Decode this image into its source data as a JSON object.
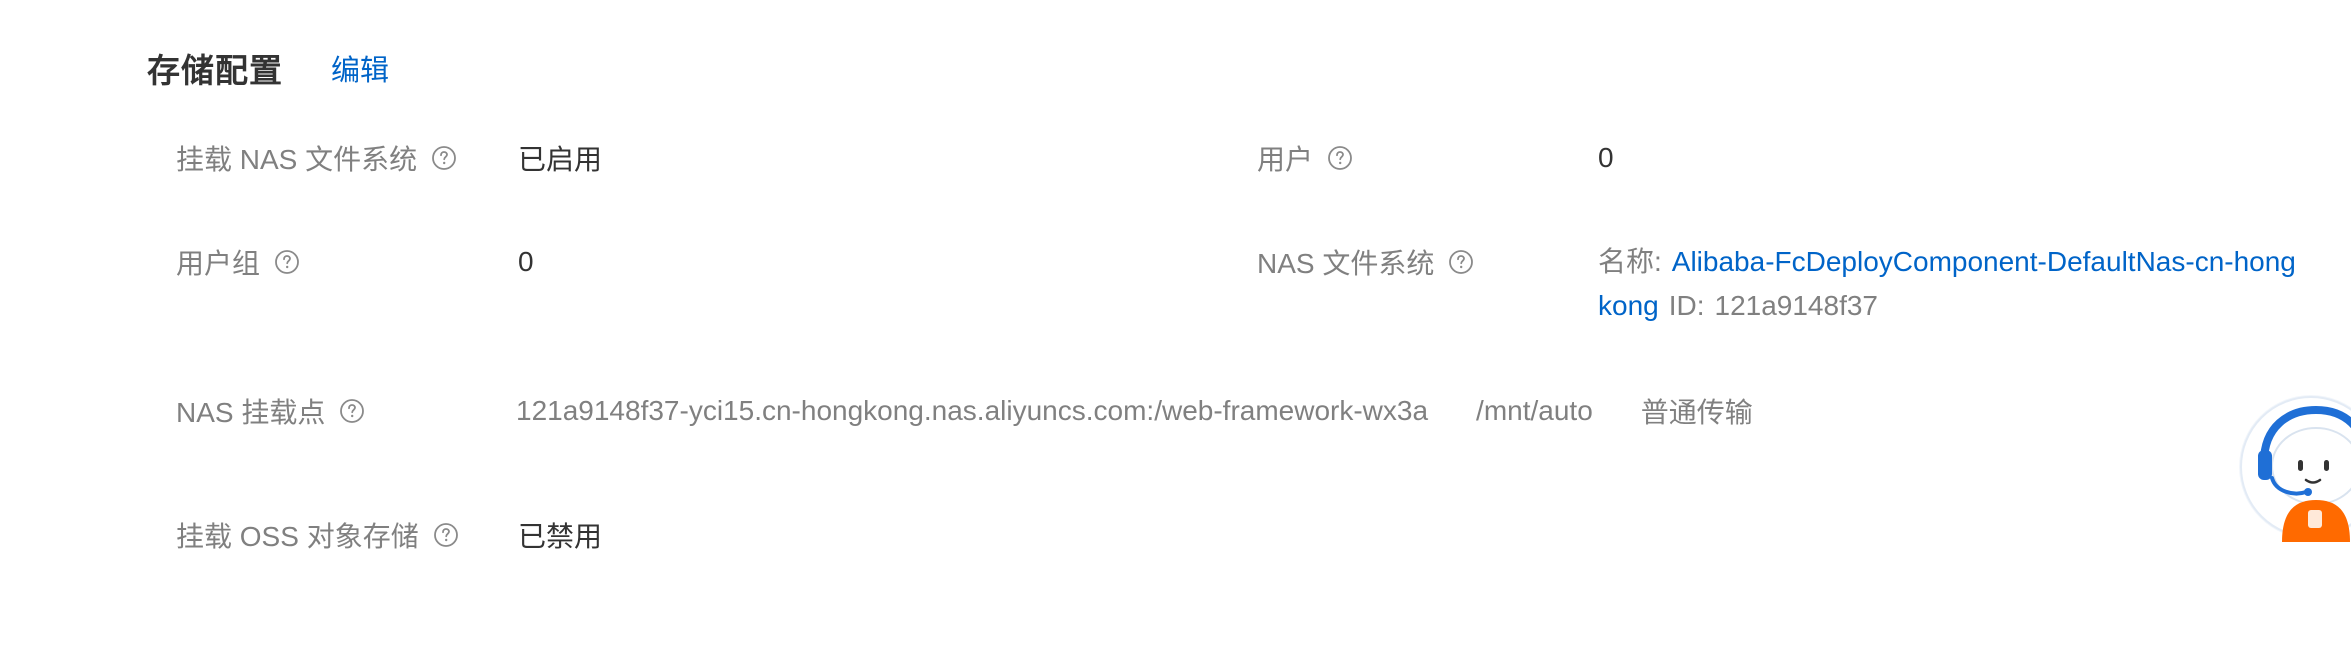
{
  "section": {
    "title": "存储配置",
    "edit_label": "编辑"
  },
  "fields": {
    "mount_nas": {
      "label": "挂载 NAS 文件系统",
      "value": "已启用"
    },
    "user": {
      "label": "用户",
      "value": "0"
    },
    "user_group": {
      "label": "用户组",
      "value": "0"
    },
    "nas_fs": {
      "label": "NAS 文件系统",
      "name_prefix": "名称:",
      "name_value": "Alibaba-FcDeployComponent-DefaultNas-cn-hongkong",
      "id_prefix": "ID:",
      "id_value": "121a9148f37"
    },
    "nas_mount_point": {
      "label": "NAS 挂载点",
      "server_path": "121a9148f37-yci15.cn-hongkong.nas.aliyuncs.com:/web-framework-wx3a",
      "local_path": "/mnt/auto",
      "transfer_mode": "普通传输"
    },
    "mount_oss": {
      "label": "挂载 OSS 对象存储",
      "value": "已禁用"
    }
  },
  "colors": {
    "link": "#0064c8",
    "label": "#808080",
    "text": "#333333",
    "assistant_accent": "#ff6a00",
    "assistant_headset": "#1f6fd6"
  },
  "icons": {
    "help": "question-circle-icon",
    "assistant": "assistant-robot-icon"
  }
}
